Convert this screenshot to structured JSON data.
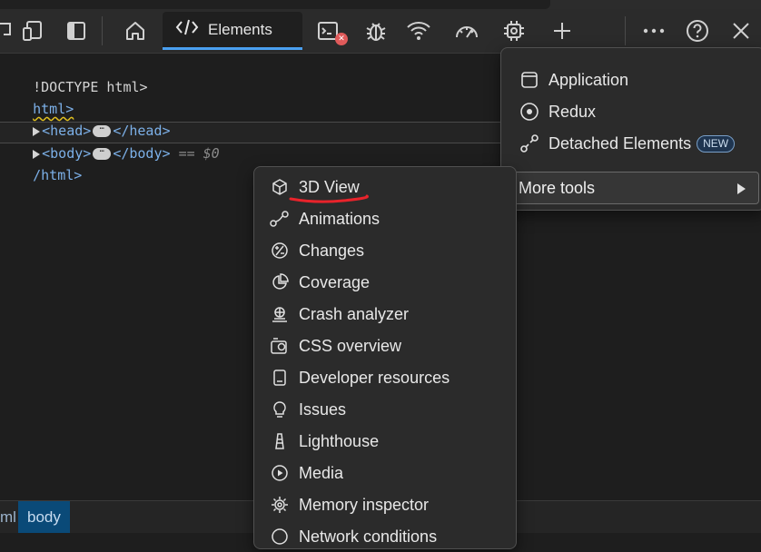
{
  "toolbar": {
    "elements_tab_label": "Elements"
  },
  "code": {
    "line1": "!DOCTYPE html>",
    "line2": "html>",
    "head_open": "<head>",
    "head_close": "</head>",
    "body_open": "<body>",
    "body_close": "</body>",
    "selected_marker": "== $0",
    "line5": "/html>",
    "ellipsis": "⋯"
  },
  "breadcrumbs": [
    "ml",
    "body"
  ],
  "top_menu": {
    "items": [
      {
        "label": "Application",
        "icon": "application-icon"
      },
      {
        "label": "Redux",
        "icon": "redux-icon"
      },
      {
        "label": "Detached Elements",
        "icon": "detached-elements-icon",
        "badge": "NEW"
      }
    ],
    "more_tools_label": "More tools"
  },
  "more_tools_menu": {
    "items": [
      {
        "label": "3D View",
        "icon": "cube-icon"
      },
      {
        "label": "Animations",
        "icon": "animations-icon"
      },
      {
        "label": "Changes",
        "icon": "changes-icon"
      },
      {
        "label": "Coverage",
        "icon": "coverage-icon"
      },
      {
        "label": "Crash analyzer",
        "icon": "crash-analyzer-icon"
      },
      {
        "label": "CSS overview",
        "icon": "css-overview-icon"
      },
      {
        "label": "Developer resources",
        "icon": "developer-resources-icon"
      },
      {
        "label": "Issues",
        "icon": "issues-icon"
      },
      {
        "label": "Lighthouse",
        "icon": "lighthouse-icon"
      },
      {
        "label": "Media",
        "icon": "media-icon"
      },
      {
        "label": "Memory inspector",
        "icon": "memory-inspector-icon"
      },
      {
        "label": "Network conditions",
        "icon": "network-conditions-icon"
      }
    ]
  },
  "colors": {
    "accent": "#4aa0f0",
    "annotation": "#e8232b"
  }
}
